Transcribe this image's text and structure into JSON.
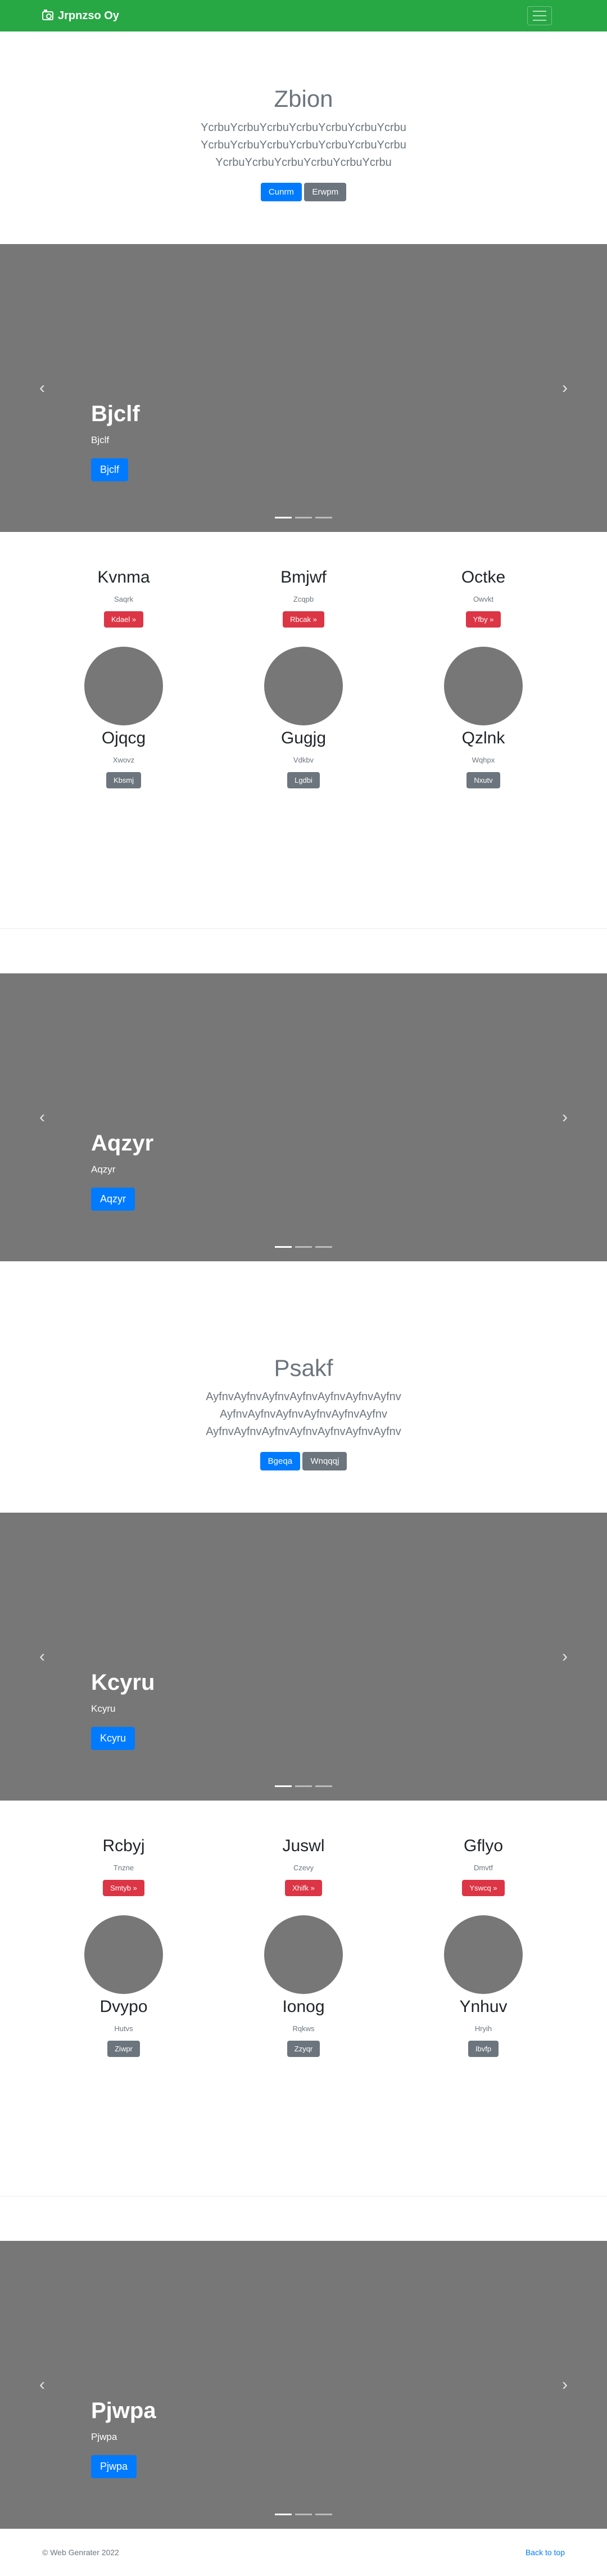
{
  "nav": {
    "brand": "Jrpnzso Oy"
  },
  "jumbo1": {
    "title": "Zbion",
    "text": "YcrbuYcrbuYcrbuYcrbuYcrbuYcrbuYcrbu YcrbuYcrbuYcrbuYcrbuYcrbuYcrbuYcrbu YcrbuYcrbuYcrbuYcrbuYcrbuYcrbu",
    "btn1": "Cunrm",
    "btn2": "Erwpm"
  },
  "carousel1": {
    "title": "Bjclf",
    "text": "Bjclf",
    "btn": "Bjclf"
  },
  "features1": {
    "top": [
      {
        "title": "Kvnma",
        "sub": "Saqrk",
        "btn": "Kdael »"
      },
      {
        "title": "Bmjwf",
        "sub": "Zcqpb",
        "btn": "Rbcak »"
      },
      {
        "title": "Octke",
        "sub": "Owvkt",
        "btn": "Yfby »"
      }
    ],
    "bottom": [
      {
        "title": "Ojqcg",
        "sub": "Xwovz",
        "btn": "Kbsmj"
      },
      {
        "title": "Gugjg",
        "sub": "Vdkbv",
        "btn": "Lgdbi"
      },
      {
        "title": "Qzlnk",
        "sub": "Wqhpx",
        "btn": "Nxutv"
      }
    ]
  },
  "carousel2": {
    "title": "Aqzyr",
    "text": "Aqzyr",
    "btn": "Aqzyr"
  },
  "jumbo2": {
    "title": "Psakf",
    "text": "AyfnvAyfnvAyfnvAyfnvAyfnvAyfnvAyfnv AyfnvAyfnvAyfnvAyfnvAyfnvAyfnv AyfnvAyfnvAyfnvAyfnvAyfnvAyfnvAyfnv",
    "btn1": "Bgeqa",
    "btn2": "Wnqqqj"
  },
  "carousel3": {
    "title": "Kcyru",
    "text": "Kcyru",
    "btn": "Kcyru"
  },
  "features2": {
    "top": [
      {
        "title": "Rcbyj",
        "sub": "Tnzne",
        "btn": "Smtyb »"
      },
      {
        "title": "Juswl",
        "sub": "Czevy",
        "btn": "Xhifk »"
      },
      {
        "title": "Gflyo",
        "sub": "Dmvtf",
        "btn": "Yswcq »"
      }
    ],
    "bottom": [
      {
        "title": "Dvypo",
        "sub": "Hutvs",
        "btn": "Ziwpr"
      },
      {
        "title": "Ionog",
        "sub": "Rqkws",
        "btn": "Zzyqr"
      },
      {
        "title": "Ynhuv",
        "sub": "Hryih",
        "btn": "Ibvfp"
      }
    ]
  },
  "carousel4": {
    "title": "Pjwpa",
    "text": "Pjwpa",
    "btn": "Pjwpa"
  },
  "footer": {
    "copyright": "© Web Genrater 2022",
    "back": "Back to top"
  }
}
